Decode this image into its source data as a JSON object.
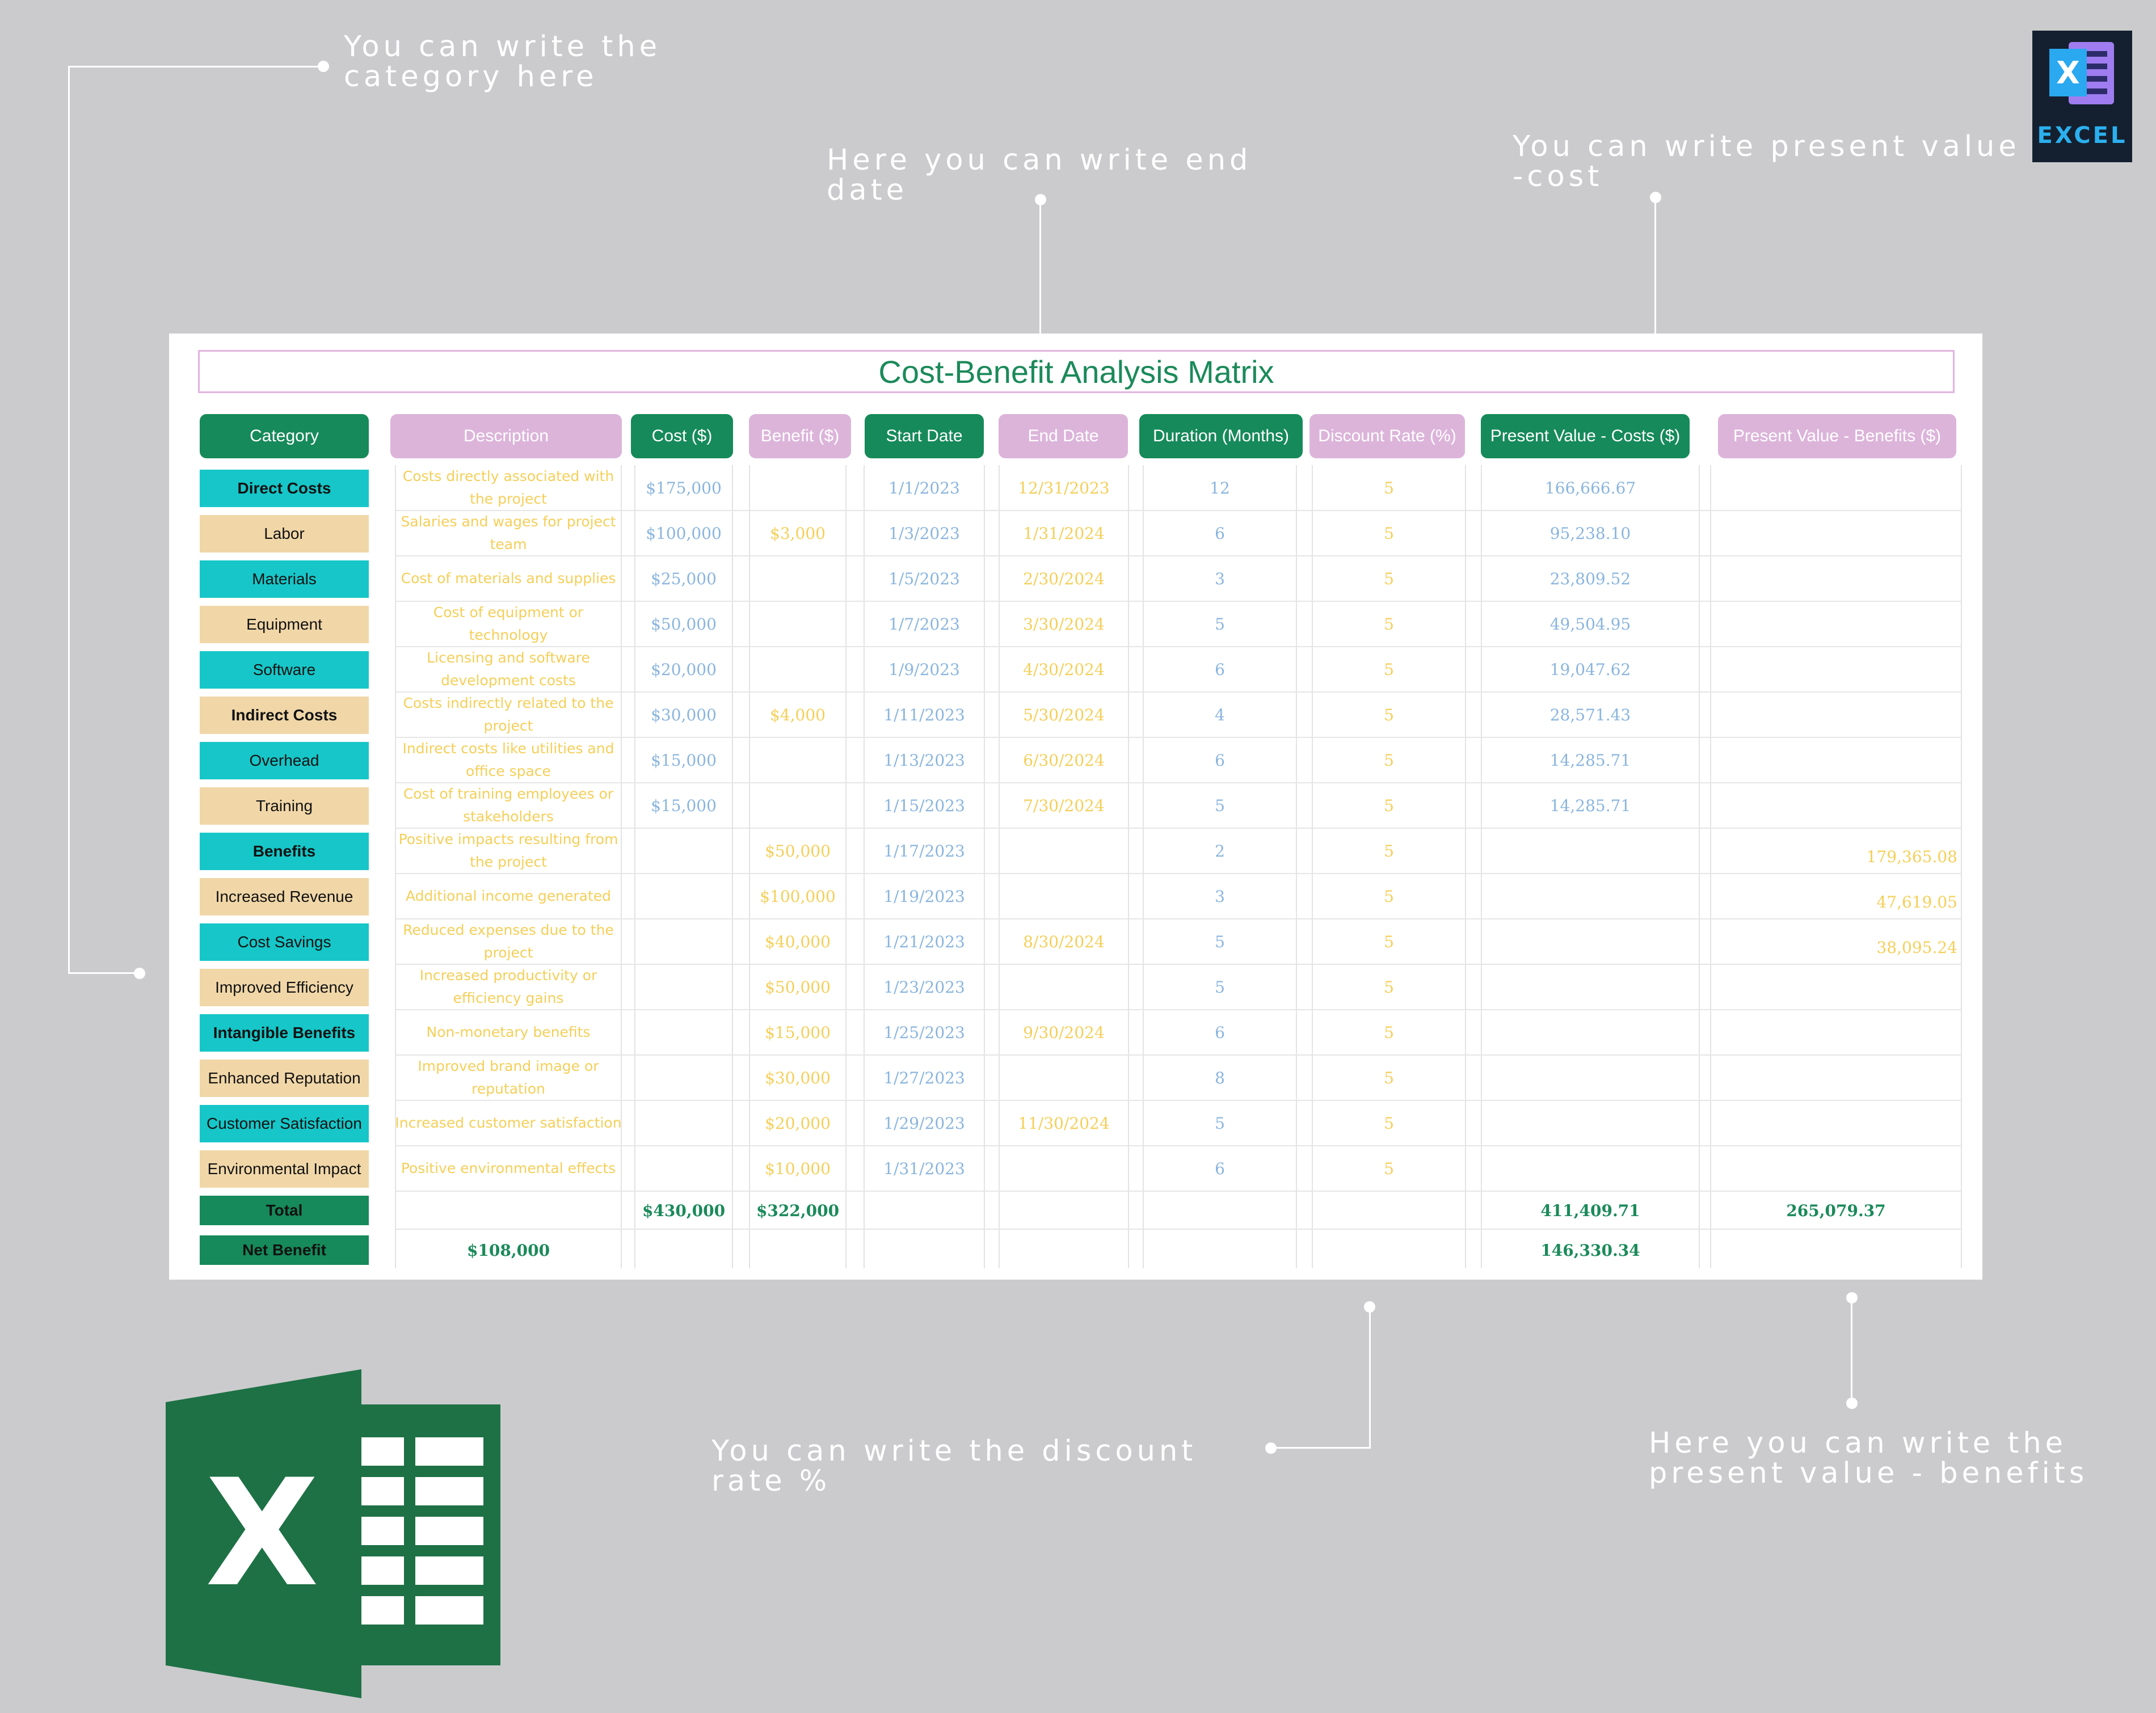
{
  "callouts": {
    "category": "You can write the category here",
    "end_date": "Here you can write end date",
    "pv_cost": "You can write present value -cost",
    "discount": "You can write the discount rate %",
    "pv_benefits": "Here you can write the present value - benefits"
  },
  "badge": {
    "label": "EXCEL"
  },
  "sheet": {
    "title": "Cost-Benefit Analysis Matrix",
    "headers": {
      "category": "Category",
      "description": "Description",
      "cost": "Cost  ($)",
      "benefit": "Benefit ($)",
      "start": "Start Date",
      "end": "End Date",
      "duration": "Duration (Months)",
      "discount": "Discount Rate (%)",
      "pv_costs": "Present Value - Costs ($)",
      "pv_benefits": "Present Value - Benefits ($)"
    },
    "rows": [
      {
        "cat": "Direct Costs",
        "style": "cyan",
        "bold": true,
        "desc": "Costs directly associated with the project",
        "cost": "$175,000",
        "benefit": "",
        "start": "1/1/2023",
        "end": "12/31/2023",
        "dur": "12",
        "rate": "5",
        "pvc": "166,666.67",
        "pvb": ""
      },
      {
        "cat": "Labor",
        "style": "tan",
        "bold": false,
        "desc": "Salaries and wages for project team",
        "cost": "$100,000",
        "benefit": "$3,000",
        "start": "1/3/2023",
        "end": "1/31/2024",
        "dur": "6",
        "rate": "5",
        "pvc": "95,238.10",
        "pvb": ""
      },
      {
        "cat": "Materials",
        "style": "cyan",
        "bold": false,
        "desc": "Cost of materials and supplies",
        "cost": "$25,000",
        "benefit": "",
        "start": "1/5/2023",
        "end": "2/30/2024",
        "dur": "3",
        "rate": "5",
        "pvc": "23,809.52",
        "pvb": ""
      },
      {
        "cat": "Equipment",
        "style": "tan",
        "bold": false,
        "desc": "Cost of equipment or technology",
        "cost": "$50,000",
        "benefit": "",
        "start": "1/7/2023",
        "end": "3/30/2024",
        "dur": "5",
        "rate": "5",
        "pvc": "49,504.95",
        "pvb": ""
      },
      {
        "cat": "Software",
        "style": "cyan",
        "bold": false,
        "desc": "Licensing and software development costs",
        "cost": "$20,000",
        "benefit": "",
        "start": "1/9/2023",
        "end": "4/30/2024",
        "dur": "6",
        "rate": "5",
        "pvc": "19,047.62",
        "pvb": ""
      },
      {
        "cat": "Indirect Costs",
        "style": "tan",
        "bold": true,
        "desc": "Costs indirectly related to the project",
        "cost": "$30,000",
        "benefit": "$4,000",
        "start": "1/11/2023",
        "end": "5/30/2024",
        "dur": "4",
        "rate": "5",
        "pvc": "28,571.43",
        "pvb": ""
      },
      {
        "cat": "Overhead",
        "style": "cyan",
        "bold": false,
        "desc": "Indirect costs like utilities and office space",
        "cost": "$15,000",
        "benefit": "",
        "start": "1/13/2023",
        "end": "6/30/2024",
        "dur": "6",
        "rate": "5",
        "pvc": "14,285.71",
        "pvb": ""
      },
      {
        "cat": "Training",
        "style": "tan",
        "bold": false,
        "desc": "Cost of training employees or stakeholders",
        "cost": "$15,000",
        "benefit": "",
        "start": "1/15/2023",
        "end": "7/30/2024",
        "dur": "5",
        "rate": "5",
        "pvc": "14,285.71",
        "pvb": ""
      },
      {
        "cat": "Benefits",
        "style": "cyan",
        "bold": true,
        "desc": "Positive impacts resulting from the project",
        "cost": "",
        "benefit": "$50,000",
        "start": "1/17/2023",
        "end": "",
        "dur": "2",
        "rate": "5",
        "pvc": "",
        "pvb": "179,365.08"
      },
      {
        "cat": "Increased Revenue",
        "style": "tan",
        "bold": false,
        "desc": "Additional income generated",
        "cost": "",
        "benefit": "$100,000",
        "start": "1/19/2023",
        "end": "",
        "dur": "3",
        "rate": "5",
        "pvc": "",
        "pvb": "47,619.05"
      },
      {
        "cat": "Cost Savings",
        "style": "cyan",
        "bold": false,
        "desc": "Reduced expenses due to the project",
        "cost": "",
        "benefit": "$40,000",
        "start": "1/21/2023",
        "end": "8/30/2024",
        "dur": "5",
        "rate": "5",
        "pvc": "",
        "pvb": "38,095.24"
      },
      {
        "cat": "Improved Efficiency",
        "style": "tan",
        "bold": false,
        "desc": "Increased productivity or efficiency gains",
        "cost": "",
        "benefit": "$50,000",
        "start": "1/23/2023",
        "end": "",
        "dur": "5",
        "rate": "5",
        "pvc": "",
        "pvb": ""
      },
      {
        "cat": "Intangible Benefits",
        "style": "cyan",
        "bold": true,
        "desc": "Non-monetary benefits",
        "cost": "",
        "benefit": "$15,000",
        "start": "1/25/2023",
        "end": "9/30/2024",
        "dur": "6",
        "rate": "5",
        "pvc": "",
        "pvb": ""
      },
      {
        "cat": "Enhanced Reputation",
        "style": "tan",
        "bold": false,
        "desc": "Improved brand image or reputation",
        "cost": "",
        "benefit": "$30,000",
        "start": "1/27/2023",
        "end": "",
        "dur": "8",
        "rate": "5",
        "pvc": "",
        "pvb": ""
      },
      {
        "cat": "Customer Satisfaction",
        "style": "cyan",
        "bold": false,
        "desc": "Increased customer satisfaction",
        "cost": "",
        "benefit": "$20,000",
        "start": "1/29/2023",
        "end": "11/30/2024",
        "dur": "5",
        "rate": "5",
        "pvc": "",
        "pvb": ""
      },
      {
        "cat": "Environmental Impact",
        "style": "tan",
        "bold": false,
        "desc": "Positive environmental effects",
        "cost": "",
        "benefit": "$10,000",
        "start": "1/31/2023",
        "end": "",
        "dur": "6",
        "rate": "5",
        "pvc": "",
        "pvb": ""
      }
    ],
    "total": {
      "label": "Total",
      "cost": "$430,000",
      "benefit": "$322,000",
      "pvc": "411,409.71",
      "pvb": "265,079.37"
    },
    "net": {
      "label": "Net Benefit",
      "desc": "$108,000",
      "pvc": "146,330.34"
    }
  },
  "colors": {
    "green": "#168a5a",
    "cyan": "#17c6c8",
    "tan": "#f1d7a8",
    "pink": "#dcb4da",
    "blue_text": "#8ab5de",
    "yellow_text": "#f5cf59"
  }
}
